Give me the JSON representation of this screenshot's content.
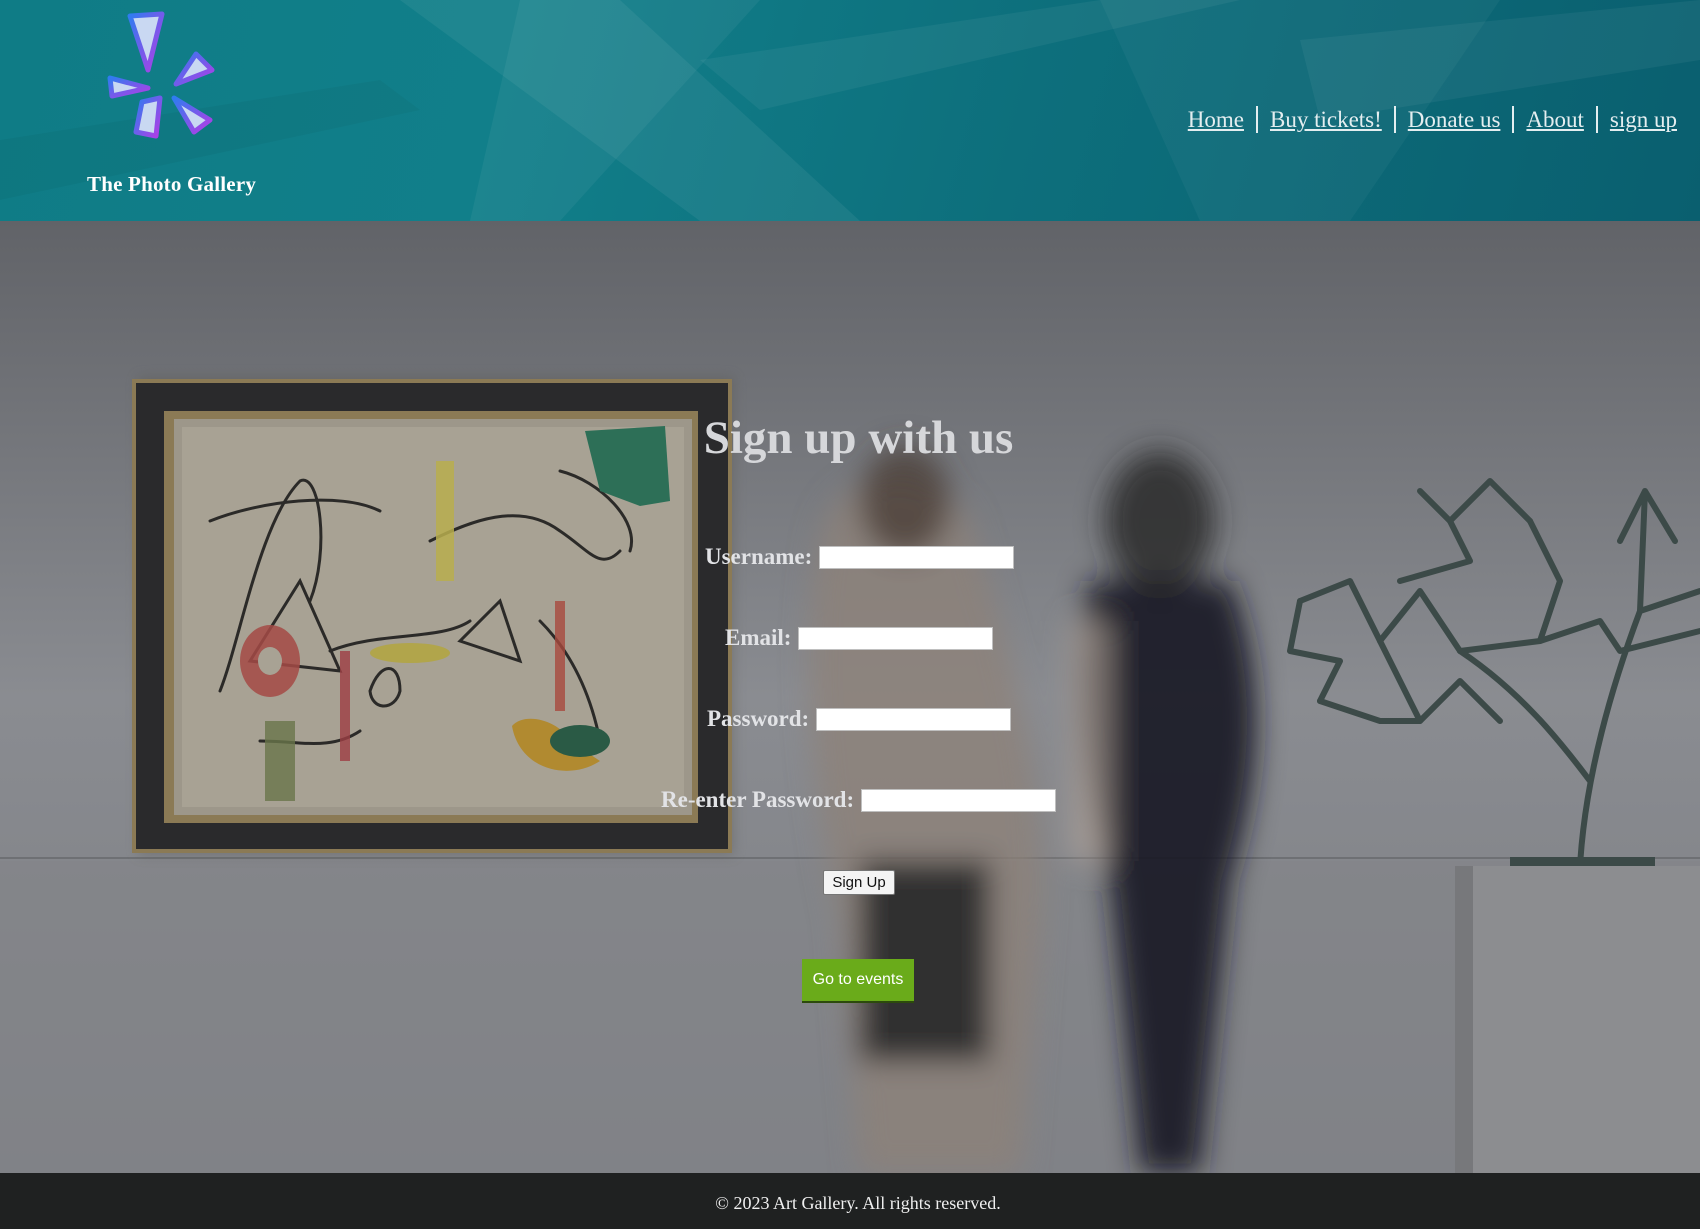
{
  "header": {
    "site_title": "The Photo Gallery",
    "logo_icon": "pinwheel-logo-icon",
    "background_color": "#0f7c86"
  },
  "nav": {
    "items": [
      {
        "label": "Home"
      },
      {
        "label": "Buy tickets!"
      },
      {
        "label": "Donate us"
      },
      {
        "label": "About"
      },
      {
        "label": "sign up"
      }
    ]
  },
  "form": {
    "title": "Sign up with us",
    "fields": [
      {
        "label": "Username:",
        "value": ""
      },
      {
        "label": "Email:",
        "value": ""
      },
      {
        "label": "Password:",
        "value": ""
      },
      {
        "label": "Re-enter Password:",
        "value": ""
      }
    ],
    "submit_label": "Sign Up",
    "events_label": "Go to events",
    "events_button_color": "#6aab1a"
  },
  "footer": {
    "text": "© 2023 Art Gallery. All rights reserved."
  }
}
